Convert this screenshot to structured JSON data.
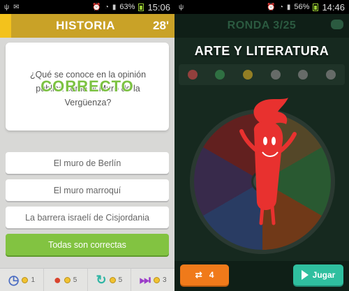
{
  "left": {
    "status": {
      "battery": "63%",
      "time": "15:06"
    },
    "header": {
      "title": "HISTORIA",
      "timer": "28'"
    },
    "question": {
      "text": "¿Qué se conoce en la opinión pública como el Muro de la Vergüenza?",
      "result": "CORRECTO"
    },
    "answers": [
      {
        "label": "El muro de Berlín"
      },
      {
        "label": "El muro marroquí"
      },
      {
        "label": "La barrera israelí de Cisjordania"
      },
      {
        "label": "Todas son correctas"
      }
    ],
    "powerups": [
      {
        "icon": "clock-icon",
        "cost": "1"
      },
      {
        "icon": "bomb-icon",
        "cost": "5"
      },
      {
        "icon": "refresh-icon",
        "cost": "5"
      },
      {
        "icon": "skip-icon",
        "cost": "3"
      }
    ]
  },
  "right": {
    "status": {
      "battery": "56%",
      "time": "14:46"
    },
    "header": {
      "round": "RONDA 3/25"
    },
    "category": "ARTE Y LITERATURA",
    "spin_count": "4",
    "play_label": "Jugar"
  }
}
